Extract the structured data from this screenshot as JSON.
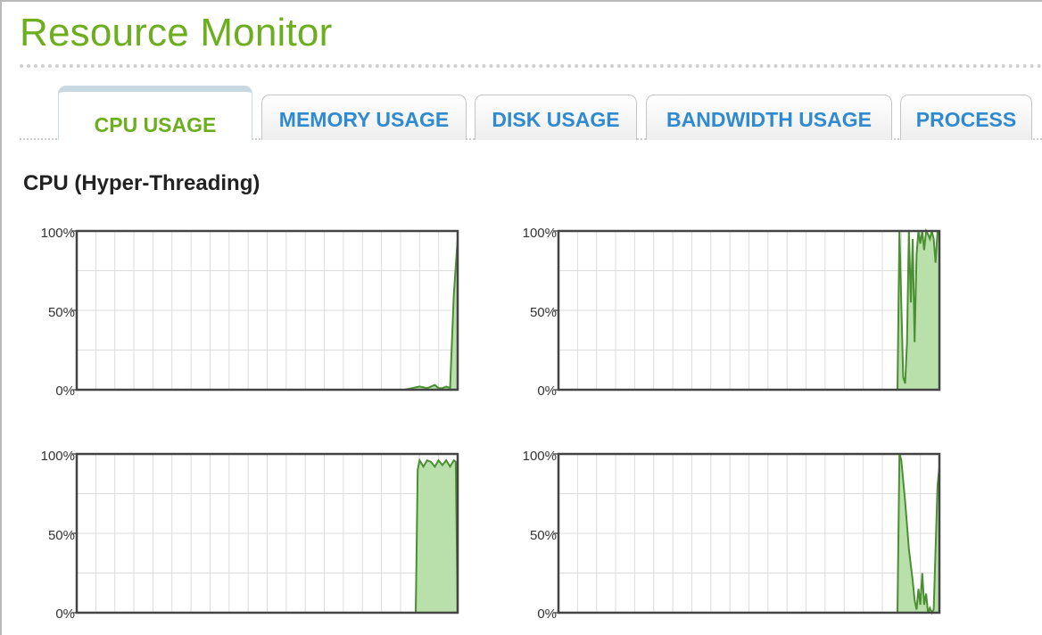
{
  "app": {
    "title": "Resource Monitor"
  },
  "tabs": [
    {
      "label": "CPU USAGE",
      "active": true
    },
    {
      "label": "MEMORY USAGE",
      "active": false
    },
    {
      "label": "DISK USAGE",
      "active": false
    },
    {
      "label": "BANDWIDTH USAGE",
      "active": false
    },
    {
      "label": "PROCESS",
      "active": false
    }
  ],
  "section": {
    "title": "CPU (Hyper-Threading)"
  },
  "colors": {
    "title": "#6cae1d",
    "tab_text": "#2f8ad0",
    "active_tab_text": "#6cae1d",
    "line": "#4a8f32",
    "fill": "#b9dfaa"
  },
  "chart_data": [
    {
      "type": "area",
      "ylim": [
        0,
        100
      ],
      "yticks": [
        "100%",
        "50%",
        "0%"
      ],
      "grid": true,
      "x": [
        0,
        86,
        88,
        90,
        92,
        94,
        95,
        96,
        97,
        98,
        99,
        100
      ],
      "values": [
        0,
        0,
        1,
        2,
        1,
        3,
        1,
        1,
        2,
        1,
        60,
        95
      ]
    },
    {
      "type": "area",
      "ylim": [
        0,
        100
      ],
      "yticks": [
        "100%",
        "50%",
        "0%"
      ],
      "grid": true,
      "x": [
        0,
        89,
        89.5,
        90.5,
        91,
        91.5,
        92,
        92.5,
        93,
        93.5,
        94,
        94.5,
        95,
        95.5,
        96,
        96.5,
        97,
        97.5,
        98,
        98.5,
        99,
        99.5,
        100
      ],
      "values": [
        0,
        0,
        100,
        8,
        4,
        30,
        100,
        55,
        95,
        30,
        85,
        100,
        92,
        100,
        88,
        100,
        98,
        95,
        100,
        95,
        80,
        100,
        100
      ]
    },
    {
      "type": "area",
      "ylim": [
        0,
        100
      ],
      "yticks": [
        "100%",
        "50%",
        "0%"
      ],
      "grid": true,
      "x": [
        0,
        89,
        89.5,
        90,
        91,
        92,
        93,
        94,
        95,
        96,
        97,
        98,
        99,
        99.5,
        100
      ],
      "values": [
        0,
        0,
        90,
        96,
        92,
        96,
        95,
        92,
        96,
        93,
        96,
        92,
        96,
        95,
        0
      ]
    },
    {
      "type": "area",
      "ylim": [
        0,
        100
      ],
      "yticks": [
        "100%",
        "50%",
        "0%"
      ],
      "grid": true,
      "x": [
        0,
        89,
        89.5,
        90,
        91,
        92,
        93,
        93.5,
        94,
        94.5,
        95,
        95.5,
        96,
        96.5,
        97,
        97.5,
        98,
        98.5,
        99,
        99.5,
        100
      ],
      "values": [
        0,
        0,
        100,
        96,
        70,
        40,
        20,
        8,
        2,
        15,
        5,
        25,
        5,
        12,
        0,
        3,
        0,
        2,
        40,
        80,
        92
      ]
    }
  ]
}
